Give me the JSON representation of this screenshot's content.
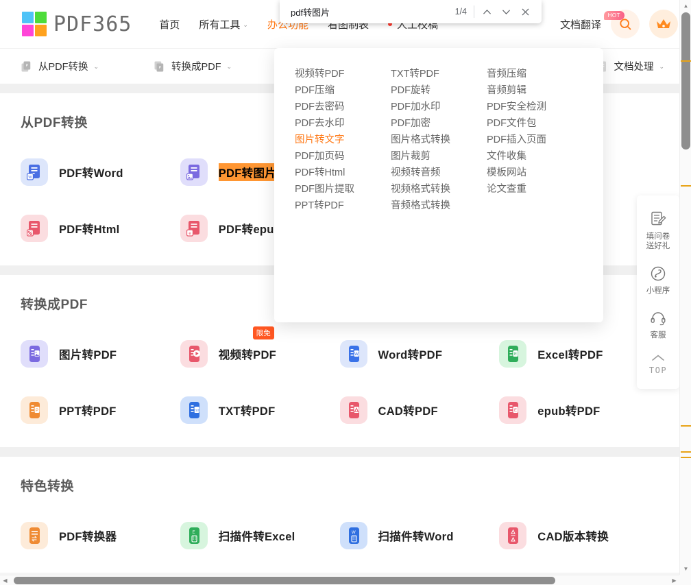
{
  "findbar": {
    "query": "pdf转图片",
    "placeholder": "",
    "count": "1/4",
    "prev_icon": "chevron-up-icon",
    "next_icon": "chevron-down-icon",
    "close_icon": "close-icon"
  },
  "header": {
    "logo_text": "PDF365",
    "nav": [
      {
        "label": "首页",
        "caret": false,
        "active": false
      },
      {
        "label": "所有工具",
        "caret": true,
        "active": false
      },
      {
        "label": "办公功能",
        "caret": false,
        "active": true
      },
      {
        "label": "看图制表",
        "caret": false,
        "active": false
      },
      {
        "label": "人工校稿",
        "caret": false,
        "active": false,
        "dot": true
      }
    ],
    "translate_label": "文档翻译",
    "hot_badge": "HOT",
    "search_icon": "search-icon",
    "vip_icon": "crown-icon"
  },
  "subnav": {
    "items": [
      {
        "label": "从PDF转换",
        "icon": "pdf-convert-from-icon",
        "caret": "⌄"
      },
      {
        "label": "转换成PDF",
        "icon": "pdf-convert-to-icon",
        "caret": "⌄"
      },
      {
        "label": "",
        "icon": "shield-star-icon",
        "caret": ""
      }
    ],
    "right": {
      "label": "文档处理",
      "icon": "document-icon",
      "caret": "⌄"
    }
  },
  "dropdown": {
    "columns": [
      [
        "视频转PDF",
        "PDF压缩",
        "PDF去密码",
        "PDF去水印",
        "图片转文字",
        "PDF加页码",
        "PDF转Html",
        "PDF图片提取",
        "PPT转PDF"
      ],
      [
        "TXT转PDF",
        "PDF旋转",
        "PDF加水印",
        "PDF加密",
        "图片格式转换",
        "图片裁剪",
        "视频转音频",
        "视频格式转换",
        "音频格式转换"
      ],
      [
        "音频压缩",
        "音频剪辑",
        "PDF安全检测",
        "PDF文件包",
        "PDF插入页面",
        "文件收集",
        "模板网站",
        "论文查重",
        ""
      ]
    ],
    "active_item": "图片转文字",
    "active_color": "#ff7a18"
  },
  "sections": [
    {
      "title": "从PDF转换",
      "tools": [
        {
          "label": "PDF转Word",
          "icon": "pdf-to-word-icon",
          "bg": "#dde6fb",
          "fg": "#4a6fe3",
          "highlight": false,
          "badge": ""
        },
        {
          "label": "PDF转图片",
          "icon": "pdf-to-image-icon",
          "bg": "#e0defb",
          "fg": "#7b6ae0",
          "highlight": true,
          "badge": ""
        },
        {
          "label": "",
          "icon": "",
          "bg": "",
          "fg": "",
          "highlight": false,
          "badge": ""
        },
        {
          "label": "",
          "icon": "",
          "bg": "",
          "fg": "",
          "highlight": false,
          "badge": ""
        },
        {
          "label": "PDF转Html",
          "icon": "pdf-to-html-icon",
          "bg": "#fbdde0",
          "fg": "#e8576b",
          "highlight": false,
          "badge": ""
        },
        {
          "label": "PDF转epub",
          "icon": "pdf-to-epub-icon",
          "bg": "#fbdde0",
          "fg": "#e8576b",
          "highlight": false,
          "badge": ""
        },
        {
          "label": "",
          "icon": "",
          "bg": "",
          "fg": "",
          "highlight": false,
          "badge": ""
        },
        {
          "label": "",
          "icon": "",
          "bg": "",
          "fg": "",
          "highlight": false,
          "badge": ""
        }
      ]
    },
    {
      "title": "转换成PDF",
      "tools": [
        {
          "label": "图片转PDF",
          "icon": "image-to-pdf-icon",
          "bg": "#e0defb",
          "fg": "#7b6ae0",
          "highlight": false,
          "badge": ""
        },
        {
          "label": "视频转PDF",
          "icon": "video-to-pdf-icon",
          "bg": "#fbdde0",
          "fg": "#e8576b",
          "highlight": false,
          "badge": "限免"
        },
        {
          "label": "Word转PDF",
          "icon": "word-to-pdf-icon",
          "bg": "#dde6fb",
          "fg": "#3a72e8",
          "highlight": false,
          "badge": ""
        },
        {
          "label": "Excel转PDF",
          "icon": "excel-to-pdf-icon",
          "bg": "#d7f5de",
          "fg": "#2fad5a",
          "highlight": false,
          "badge": ""
        },
        {
          "label": "PPT转PDF",
          "icon": "ppt-to-pdf-icon",
          "bg": "#fdebd9",
          "fg": "#ef8b33",
          "highlight": false,
          "badge": ""
        },
        {
          "label": "TXT转PDF",
          "icon": "txt-to-pdf-icon",
          "bg": "#cfe0fb",
          "fg": "#2f6fe0",
          "highlight": false,
          "badge": ""
        },
        {
          "label": "CAD转PDF",
          "icon": "cad-to-pdf-icon",
          "bg": "#fbdde0",
          "fg": "#e8576b",
          "highlight": false,
          "badge": ""
        },
        {
          "label": "epub转PDF",
          "icon": "epub-to-pdf-icon",
          "bg": "#fbdde0",
          "fg": "#e8576b",
          "highlight": false,
          "badge": ""
        }
      ]
    },
    {
      "title": "特色转换",
      "tools": [
        {
          "label": "PDF转换器",
          "icon": "pdf-converter-icon",
          "bg": "#fdebd9",
          "fg": "#ef8b33",
          "highlight": false,
          "badge": ""
        },
        {
          "label": "扫描件转Excel",
          "icon": "scan-to-excel-icon",
          "bg": "#d7f5de",
          "fg": "#2fad5a",
          "highlight": false,
          "badge": ""
        },
        {
          "label": "扫描件转Word",
          "icon": "scan-to-word-icon",
          "bg": "#cfe0fb",
          "fg": "#2f6fe0",
          "highlight": false,
          "badge": ""
        },
        {
          "label": "CAD版本转换",
          "icon": "cad-version-convert-icon",
          "bg": "#fbdde0",
          "fg": "#e8576b",
          "highlight": false,
          "badge": ""
        }
      ]
    }
  ],
  "rail": {
    "items": [
      {
        "label": "填问卷\n送好礼",
        "icon": "survey-icon"
      },
      {
        "label": "小程序",
        "icon": "miniprogram-icon"
      },
      {
        "label": "客服",
        "icon": "headset-icon"
      },
      {
        "label": "TOP",
        "icon": "arrow-up-icon"
      }
    ]
  },
  "scrollbars": {
    "vertical_up": "▲",
    "vertical_down": "▼",
    "horizontal_left": "◀",
    "horizontal_right": "▶"
  }
}
